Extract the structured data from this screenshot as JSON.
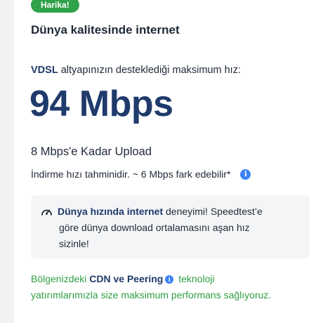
{
  "badge": "Harika!",
  "headline": "Dünya kalitesinde internet",
  "infra": {
    "type": "VDSL",
    "text": " altyapınızın desteklediği maksimum hız:"
  },
  "speed": "94 Mbps",
  "upload": "8 Mbps'e Kadar Upload",
  "estimate": "İndirme hızı tahminidir. ~ 6 Mbps fark edebilir*",
  "note": {
    "bold": "Dünya hızında internet",
    "line1_rest": " deneyimi! Speedtest’e",
    "line2": "göre dünya download ortalamasını aşan hız",
    "line3": "sizinle!"
  },
  "footer": {
    "prefix": "Bölgenizdeki ",
    "bold": "CDN ve Peering",
    "rest": " teknoloji",
    "line2": "yatırımlarımızla size maksimum performans sağlıyoruz."
  },
  "colors": {
    "accent_green": "#30a24a",
    "brand_blue": "#1f3a6b",
    "info_blue": "#3b82f6"
  },
  "icons": [
    "info-icon",
    "speedometer-icon"
  ]
}
